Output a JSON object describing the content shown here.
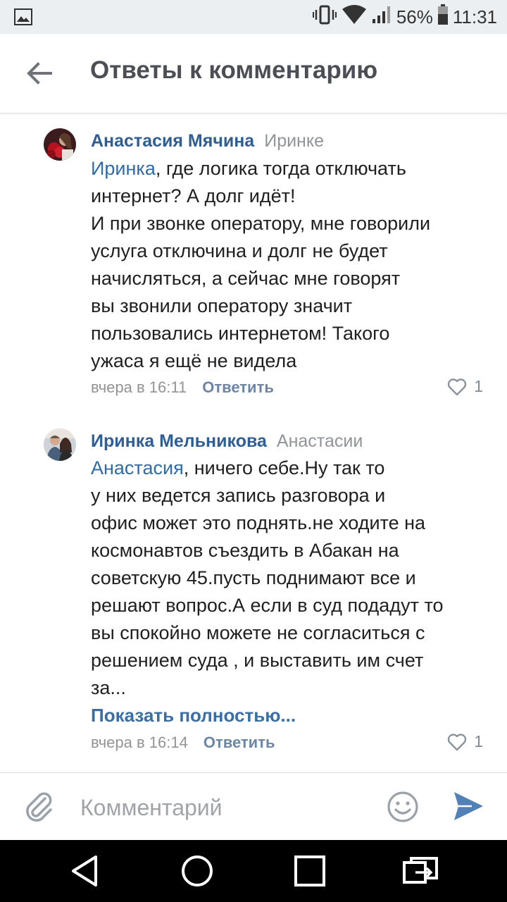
{
  "status_bar": {
    "battery": "56%",
    "time": "11:31"
  },
  "header": {
    "title": "Ответы к комментарию"
  },
  "comments": [
    {
      "author": "Анастасия Мячина",
      "reply_to": "Иринке",
      "mention": "Иринка",
      "lines": [
        ", где логика тогда отключать",
        "интернет? А долг идёт!",
        "И при звонке оператору, мне говорили",
        "услуга отключина и долг не будет",
        "начисляться, а сейчас мне говорят",
        "вы звонили оператору значит",
        "пользовались интернетом! Такого",
        "ужаса я ещё не видела"
      ],
      "time": "вчера в 16:11",
      "reply_label": "Ответить",
      "likes": "1"
    },
    {
      "author": "Иринка Мельникова",
      "reply_to": "Анастасии",
      "mention": "Анастасия",
      "lines": [
        ", ничего себе.Ну так то",
        "у них ведется запись разговора и",
        "офис может это поднять.не ходите на",
        "космонавтов съездить в Абакан на",
        "советскую 45.пусть поднимают все и",
        "решают вопрос.А если в суд подадут то",
        "вы спокойно можете не согласиться с",
        "решением суда , и выставить им счет",
        "за..."
      ],
      "show_more": "Показать полностью...",
      "time": "вчера в 16:14",
      "reply_label": "Ответить",
      "likes": "1"
    }
  ],
  "composer": {
    "placeholder": "Комментарий"
  },
  "icons": {
    "back": "arrow-left-icon",
    "attach": "paperclip-icon",
    "emoji": "smiley-icon",
    "send": "send-icon",
    "like": "heart-icon"
  },
  "colors": {
    "link": "#2f5e94",
    "send": "#5181b8"
  }
}
